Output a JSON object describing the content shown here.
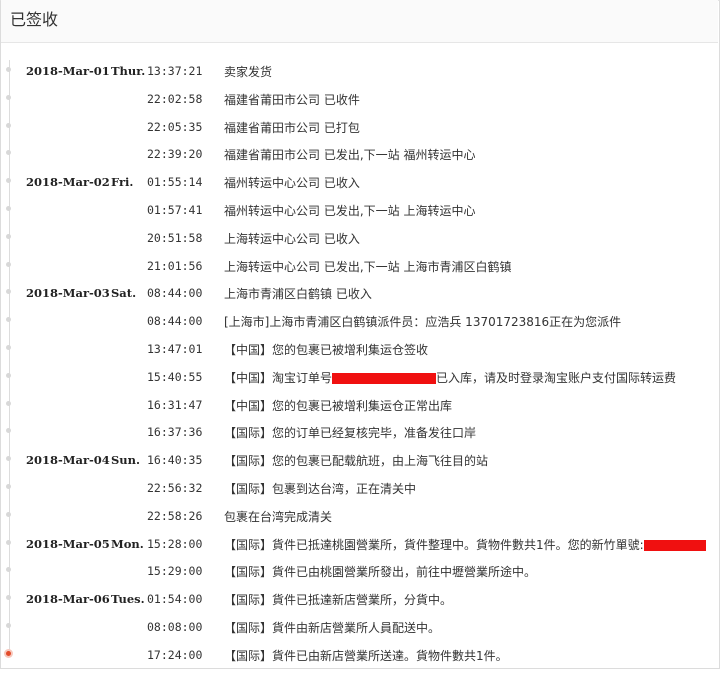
{
  "header": {
    "title": "已签收"
  },
  "colors": {
    "redaction": "#f01010",
    "active_dot": "#e34b2a"
  },
  "events": [
    {
      "date": "2018-Mar-01",
      "dow": "Thur.",
      "time": "13:37:21",
      "text": "卖家发货"
    },
    {
      "date": "",
      "dow": "",
      "time": "22:02:58",
      "text": "福建省莆田市公司 已收件"
    },
    {
      "date": "",
      "dow": "",
      "time": "22:05:35",
      "text": "福建省莆田市公司 已打包"
    },
    {
      "date": "",
      "dow": "",
      "time": "22:39:20",
      "text": "福建省莆田市公司 已发出,下一站 福州转运中心"
    },
    {
      "date": "2018-Mar-02",
      "dow": "Fri.",
      "time": "01:55:14",
      "text": "福州转运中心公司 已收入"
    },
    {
      "date": "",
      "dow": "",
      "time": "01:57:41",
      "text": "福州转运中心公司 已发出,下一站 上海转运中心"
    },
    {
      "date": "",
      "dow": "",
      "time": "20:51:58",
      "text": "上海转运中心公司 已收入"
    },
    {
      "date": "",
      "dow": "",
      "time": "21:01:56",
      "text": "上海转运中心公司 已发出,下一站 上海市青浦区白鹤镇"
    },
    {
      "date": "2018-Mar-03",
      "dow": "Sat.",
      "time": "08:44:00",
      "text": "上海市青浦区白鹤镇 已收入"
    },
    {
      "date": "",
      "dow": "",
      "time": "08:44:00",
      "text": "[上海市]上海市青浦区白鹤镇派件员：应浩兵 13701723816正在为您派件"
    },
    {
      "date": "",
      "dow": "",
      "time": "13:47:01",
      "text": "【中国】您的包裹已被增利集运仓签收"
    },
    {
      "date": "",
      "dow": "",
      "time": "15:40:55",
      "text": "【中国】淘宝订单号",
      "redact_width": 104,
      "text_after": "已入库，请及时登录淘宝账户支付国际转运费"
    },
    {
      "date": "",
      "dow": "",
      "time": "16:31:47",
      "text": "【中国】您的包裹已被增利集运仓正常出库"
    },
    {
      "date": "",
      "dow": "",
      "time": "16:37:36",
      "text": "【国际】您的订单已经复核完毕，准备发往口岸"
    },
    {
      "date": "2018-Mar-04",
      "dow": "Sun.",
      "time": "16:40:35",
      "text": "【国际】您的包裹已配载航班，由上海飞往目的站"
    },
    {
      "date": "",
      "dow": "",
      "time": "22:56:32",
      "text": "【国际】包裹到达台湾，正在清关中"
    },
    {
      "date": "",
      "dow": "",
      "time": "22:58:26",
      "text": "包裹在台湾完成清关"
    },
    {
      "date": "2018-Mar-05",
      "dow": "Mon.",
      "time": "15:28:00",
      "text": "【国际】貨件已抵達桃園營業所，貨件整理中。貨物件數共1件。您的新竹單號:",
      "redact_width": 62,
      "text_after": ""
    },
    {
      "date": "",
      "dow": "",
      "time": "15:29:00",
      "text": "【国际】貨件已由桃園營業所發出，前往中壢營業所途中。"
    },
    {
      "date": "2018-Mar-06",
      "dow": "Tues.",
      "time": "01:54:00",
      "text": "【国际】貨件已抵達新店營業所，分貨中。"
    },
    {
      "date": "",
      "dow": "",
      "time": "08:08:00",
      "text": "【国际】貨件由新店營業所人員配送中。"
    },
    {
      "date": "",
      "dow": "",
      "time": "17:24:00",
      "text": "【国际】貨件已由新店營業所送達。貨物件數共1件。",
      "active": true
    }
  ]
}
